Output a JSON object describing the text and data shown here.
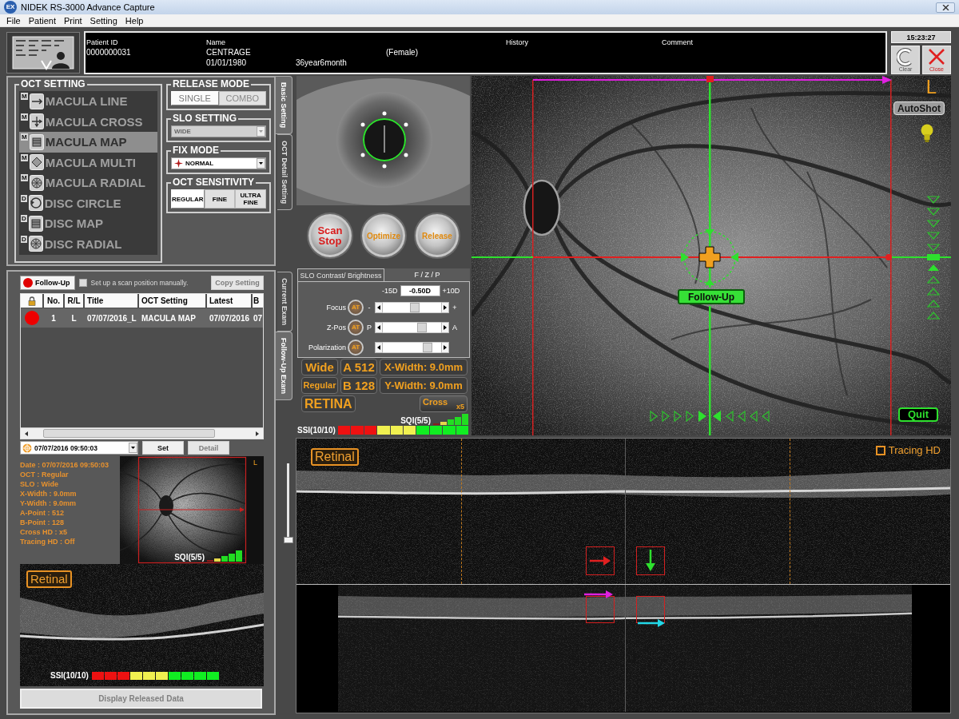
{
  "window": {
    "logo": "EX",
    "title": "NIDEK RS-3000 Advance Capture"
  },
  "menu": [
    "File",
    "Patient",
    "Print",
    "Setting",
    "Help"
  ],
  "patient": {
    "id_label": "Patient ID",
    "id": "0000000031",
    "name_label": "Name",
    "name": "CENTRAGE",
    "sex": "(Female)",
    "birth_date": "01/01/1980",
    "age": "36year6month",
    "history_label": "History",
    "comment_label": "Comment"
  },
  "clock": "15:23:27",
  "header_buttons": [
    {
      "kind": "clear",
      "label": "Clear"
    },
    {
      "kind": "close",
      "label": "Close"
    }
  ],
  "oct_setting": {
    "title": "OCT SETTING",
    "items": [
      {
        "label": "MACULA LINE",
        "badge": "M",
        "kind": "line",
        "selected": false
      },
      {
        "label": "MACULA CROSS",
        "badge": "M",
        "kind": "cross",
        "selected": false
      },
      {
        "label": "MACULA MAP",
        "badge": "M",
        "kind": "map",
        "selected": true
      },
      {
        "label": "MACULA MULTI",
        "badge": "M",
        "kind": "multi",
        "selected": false
      },
      {
        "label": "MACULA RADIAL",
        "badge": "M",
        "kind": "radial",
        "selected": false
      },
      {
        "label": "DISC CIRCLE",
        "badge": "D",
        "kind": "circle",
        "selected": false
      },
      {
        "label": "DISC MAP",
        "badge": "D",
        "kind": "map",
        "selected": false
      },
      {
        "label": "DISC RADIAL",
        "badge": "D",
        "kind": "radial",
        "selected": false
      }
    ]
  },
  "release_mode": {
    "title": "RELEASE MODE",
    "options": [
      {
        "label": "SINGLE",
        "selected": true
      },
      {
        "label": "COMBO",
        "selected": false
      }
    ]
  },
  "slo_setting": {
    "title": "SLO SETTING",
    "value": "WIDE",
    "disabled": true
  },
  "fix_mode": {
    "title": "FIX MODE",
    "value": "NORMAL",
    "disabled": false
  },
  "oct_sensitivity": {
    "title": "OCT SENSITIVITY",
    "options": [
      {
        "label": "REGULAR",
        "selected": true
      },
      {
        "label": "FINE",
        "selected": false
      },
      {
        "label": "ULTRA FINE",
        "selected": false
      }
    ]
  },
  "setting_tabs": [
    {
      "label": "Basic Setting",
      "selected": true
    },
    {
      "label": "OCT Detail Setting",
      "selected": false
    }
  ],
  "exam_tabs": [
    {
      "label": "Current Exam",
      "selected": false
    },
    {
      "label": "Follow-Up Exam",
      "selected": true
    }
  ],
  "side_slider": {
    "level": 0
  },
  "action_buttons": [
    {
      "label": "Scan Stop",
      "kind": "stop"
    },
    {
      "label": "Optimize",
      "kind": "normal"
    },
    {
      "label": "Release",
      "kind": "normal"
    }
  ],
  "adjust_panel": {
    "tabs": [
      {
        "label": "SLO Contrast/ Brightness",
        "selected": false
      },
      {
        "label": "F / Z / P",
        "selected": true
      }
    ],
    "range_min": "-15D",
    "diopter": "-0.50D",
    "range_max": "+10D",
    "rows": [
      {
        "label": "Focus",
        "button": "AT",
        "left_mark": "-",
        "right_mark": "+",
        "level": 0.55
      },
      {
        "label": "Z-Pos",
        "button": "AT",
        "left_mark": "P",
        "right_mark": "A",
        "level": 0.7
      },
      {
        "label": "Polarization",
        "button": "AT",
        "level": 0.82
      }
    ]
  },
  "scan_info": {
    "badges": [
      {
        "label": "Wide",
        "kind": "large"
      },
      {
        "label": "A 512",
        "kind": "large"
      },
      {
        "label": "X-Width: 9.0mm",
        "kind": "wide"
      },
      {
        "label": "Regular",
        "kind": "small"
      },
      {
        "label": "B 128",
        "kind": "large"
      },
      {
        "label": "Y-Width: 9.0mm",
        "kind": "wide"
      },
      {
        "label": "RETINA",
        "kind": "span"
      }
    ],
    "cross": {
      "label": "Cross",
      "count": "x5"
    }
  },
  "quality": {
    "sqi": {
      "label": "SQI(5/5)",
      "bars": [
        {
          "color": "#8a1c1c"
        },
        {
          "color": "#e6d84a"
        },
        {
          "color": "#22dd22"
        },
        {
          "color": "#22dd22"
        },
        {
          "color": "#22dd22"
        }
      ]
    },
    "ssi": {
      "label": "SSI(10/10)",
      "segments": [
        {
          "color": "#ee1111"
        },
        {
          "color": "#ee1111"
        },
        {
          "color": "#ee1111"
        },
        {
          "color": "#f0f050"
        },
        {
          "color": "#f0f050"
        },
        {
          "color": "#f0f050"
        },
        {
          "color": "#11ee22"
        },
        {
          "color": "#11ee22"
        },
        {
          "color": "#11ee22"
        },
        {
          "color": "#11ee22"
        }
      ]
    }
  },
  "follow_up": {
    "button": "Follow-Up",
    "manual": {
      "label": "Set up a scan position manually.",
      "checked": false
    },
    "copy_button": {
      "label": "Copy Setting",
      "disabled": true
    },
    "columns": [
      "No.",
      "R/L",
      "Title",
      "OCT Setting",
      "Latest",
      "B"
    ],
    "rows": [
      {
        "color": "#ee0000",
        "cells": [
          "1",
          "L",
          "07/07/2016_L",
          "MACULA MAP",
          "07/07/2016",
          "07"
        ]
      }
    ]
  },
  "exam_select": {
    "value": "07/07/2016 09:50:03",
    "set_button": {
      "label": "Set",
      "disabled": false
    },
    "detail_button": {
      "label": "Detail",
      "disabled": true
    }
  },
  "exam_details": [
    "Date : 07/07/2016 09:50:03",
    "OCT : Regular",
    "SLO : Wide",
    "X-Width : 9.0mm",
    "Y-Width : 9.0mm",
    "A-Point : 512",
    "B-Point : 128",
    "Cross HD : x5",
    "Tracing HD : Off"
  ],
  "thumbnail": {
    "eye": "L",
    "sqi": {
      "label": "SQI(5/5)",
      "bars": [
        {
          "color": "#8a1c1c"
        },
        {
          "color": "#e6d84a"
        },
        {
          "color": "#22dd22"
        },
        {
          "color": "#22dd22"
        },
        {
          "color": "#22dd22"
        }
      ]
    }
  },
  "oct_thumbnail": {
    "label": "Retinal",
    "ssi": {
      "label": "SSI(10/10)",
      "segments": [
        {
          "color": "#ee1111"
        },
        {
          "color": "#ee1111"
        },
        {
          "color": "#ee1111"
        },
        {
          "color": "#f0f050"
        },
        {
          "color": "#f0f050"
        },
        {
          "color": "#f0f050"
        },
        {
          "color": "#11ee22"
        },
        {
          "color": "#11ee22"
        },
        {
          "color": "#11ee22"
        },
        {
          "color": "#11ee22"
        }
      ]
    }
  },
  "display_button": {
    "label": "Display Released Data",
    "disabled": true
  },
  "fundus": {
    "eye": "L",
    "autoshot": "AutoShot",
    "follow_up_label": "Follow-Up",
    "quit": "Quit"
  },
  "oct_view": {
    "label": "Retinal",
    "tracing": {
      "label": "Tracing HD",
      "checked": false
    }
  }
}
